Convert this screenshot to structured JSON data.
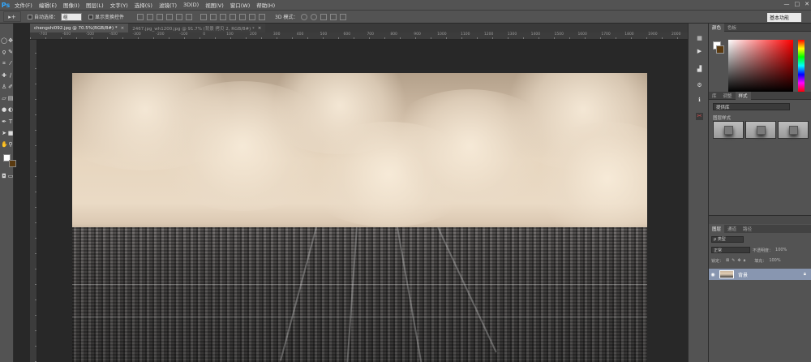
{
  "menubar": {
    "logo": "Ps",
    "items": [
      "文件(F)",
      "编辑(E)",
      "图像(I)",
      "图层(L)",
      "文字(Y)",
      "选择(S)",
      "滤镜(T)",
      "3D(D)",
      "视图(V)",
      "窗口(W)",
      "帮助(H)"
    ],
    "window_controls": [
      "—",
      "□",
      "✕"
    ]
  },
  "options": {
    "auto_select_label": "自动选择：",
    "auto_select_value": "组",
    "show_transform_label": "显示变换控件",
    "mode3d_label": "3D 模式：",
    "workspace": "基本功能"
  },
  "tabs": [
    {
      "label": "chengshi092.jpg @ 70.5%(RGB/8#) *",
      "active": true
    },
    {
      "label": "2467.jpg_wh1200.jpg @ 91.7% (背景 拷贝 2, RGB/8#) *",
      "active": false
    }
  ],
  "ruler": {
    "labels": [
      "-700",
      "-600",
      "-500",
      "-400",
      "-300",
      "-200",
      "-100",
      "0",
      "100",
      "200",
      "300",
      "400",
      "500",
      "600",
      "700",
      "800",
      "900",
      "1000",
      "1100",
      "1200",
      "1300",
      "1400",
      "1500",
      "1600",
      "1700",
      "1800",
      "1900",
      "2000"
    ]
  },
  "panels": {
    "color_tabs": [
      "颜色",
      "色板"
    ],
    "adjust_tabs": [
      "库",
      "调整",
      "样式"
    ],
    "adjust_select": "提供库",
    "styles_label": "图层样式",
    "layers_tabs": [
      "图层",
      "通道",
      "路径"
    ],
    "filter_kind": "ρ 类型",
    "blend_mode": "正常",
    "opacity_label": "不透明度：",
    "opacity_value": "100%",
    "lock_label": "锁定：",
    "fill_label": "填充：",
    "fill_value": "100%",
    "layer_name": "背景"
  },
  "colors": {
    "foreground": "#ffffff",
    "background": "#5a3a10",
    "selected_layer": "#8896b0"
  }
}
